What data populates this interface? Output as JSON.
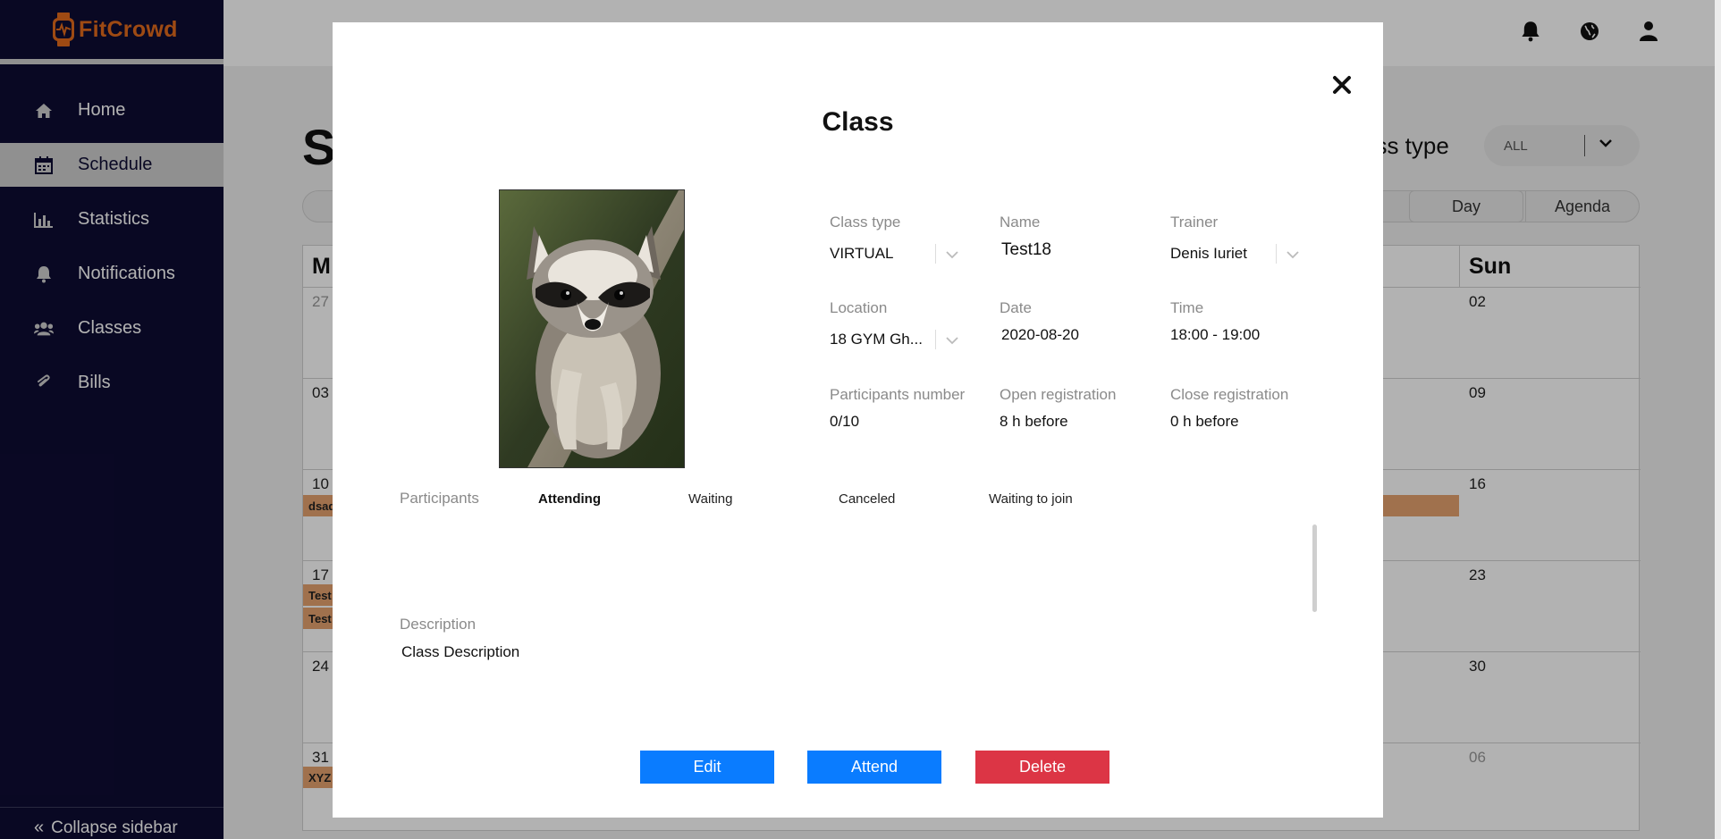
{
  "app": {
    "name": "FitCrowd"
  },
  "sidebar": {
    "items": [
      {
        "label": "Home",
        "icon": "home-icon"
      },
      {
        "label": "Schedule",
        "icon": "calendar-icon",
        "active": true
      },
      {
        "label": "Statistics",
        "icon": "bar-chart-icon"
      },
      {
        "label": "Notifications",
        "icon": "bell-icon"
      },
      {
        "label": "Classes",
        "icon": "users-icon"
      },
      {
        "label": "Bills",
        "icon": "paperclip-icon"
      }
    ],
    "collapse_label": "Collapse sidebar"
  },
  "topbar": {
    "icons": [
      "bell-icon",
      "globe-icon",
      "user-icon"
    ]
  },
  "schedule": {
    "title_visible": "S",
    "class_type_label": "ass type",
    "class_type_value": "ALL",
    "view_buttons": {
      "day": "Day",
      "agenda": "Agenda"
    },
    "headers": {
      "first": "M",
      "last": "Sun"
    },
    "rows": [
      {
        "left": "27",
        "right": "02",
        "left_muted": true
      },
      {
        "left": "03",
        "right": "09"
      },
      {
        "left": "10",
        "right": "16",
        "events": [
          "dsad"
        ]
      },
      {
        "left": "17",
        "right": "23",
        "events": [
          "Test",
          "Test"
        ]
      },
      {
        "left": "24",
        "right": "30"
      },
      {
        "left": "31",
        "right": "06",
        "right_muted": true,
        "events": [
          "XYZ"
        ]
      }
    ]
  },
  "modal": {
    "title": "Class",
    "image_alt": "Raccoon on a tree branch",
    "fields": {
      "class_type": {
        "label": "Class type",
        "value": "VIRTUAL"
      },
      "name": {
        "label": "Name",
        "value": "Test18"
      },
      "trainer": {
        "label": "Trainer",
        "value": "Denis Iuriet"
      },
      "location": {
        "label": "Location",
        "value": "18 GYM Gh..."
      },
      "date": {
        "label": "Date",
        "value": "2020-08-20"
      },
      "time": {
        "label": "Time",
        "value": "18:00 - 19:00"
      },
      "participants_number": {
        "label": "Participants number",
        "value": "0/10"
      },
      "open_registration": {
        "label": "Open registration",
        "value": "8 h before"
      },
      "close_registration": {
        "label": "Close registration",
        "value": "0 h before"
      }
    },
    "participants": {
      "label": "Participants",
      "tabs": [
        "Attending",
        "Waiting",
        "Canceled",
        "Waiting to join"
      ],
      "active_tab": "Attending"
    },
    "description": {
      "label": "Description",
      "value": "Class Description"
    },
    "buttons": {
      "edit": "Edit",
      "attend": "Attend",
      "delete": "Delete"
    },
    "colors": {
      "primary": "#0a7cff",
      "danger": "#dc3545"
    }
  }
}
